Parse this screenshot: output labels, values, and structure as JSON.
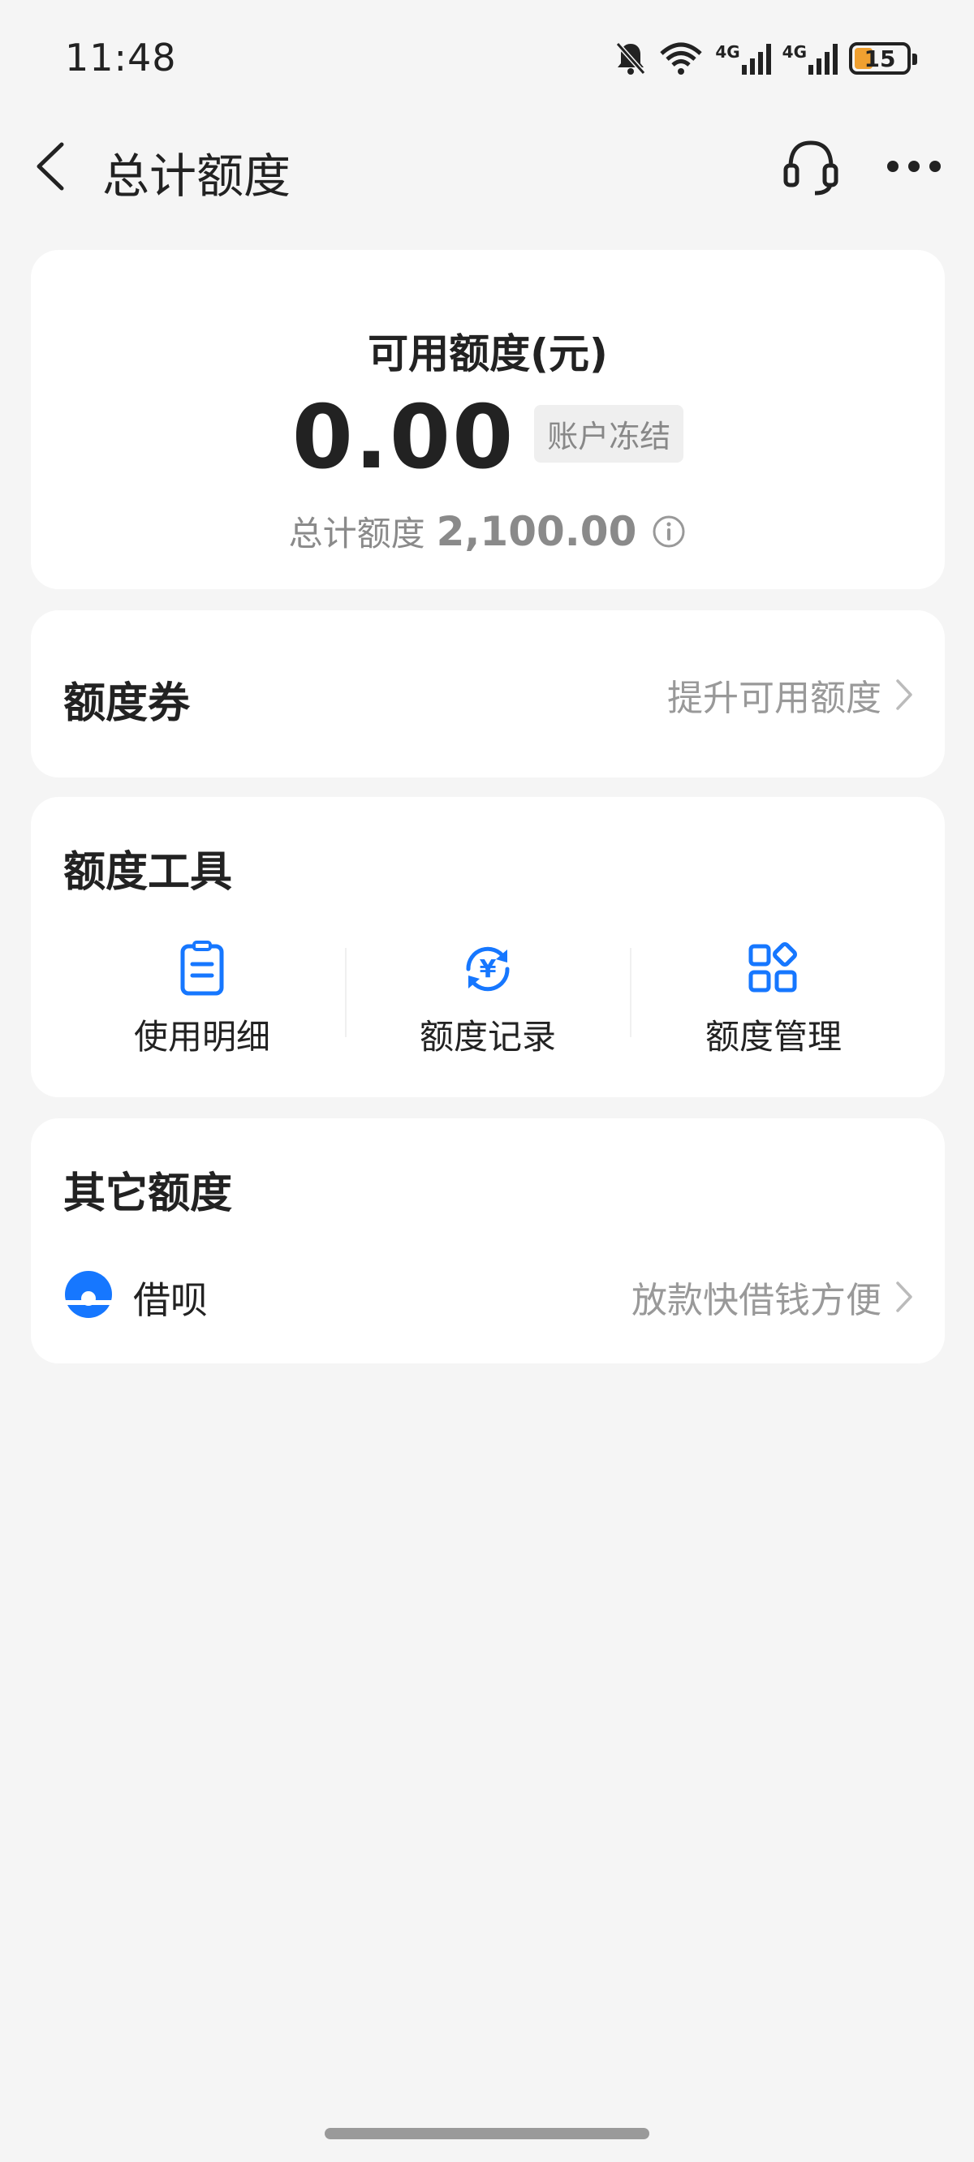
{
  "status_bar": {
    "time": "11:48",
    "network_1": "4G",
    "network_2": "4G",
    "battery": "15",
    "battery_color": "#f0a030"
  },
  "header": {
    "title": "总计额度",
    "back_icon": "chevron-left-icon",
    "service_icon": "headset-icon",
    "more_icon": "more-dots-icon"
  },
  "balance": {
    "available_label": "可用额度(元)",
    "available_amount": "0.00",
    "status_badge": "账户冻结",
    "total_label": "总计额度",
    "total_amount": "2,100.00"
  },
  "voucher": {
    "title": "额度券",
    "link_text": "提升可用额度"
  },
  "tools": {
    "title": "额度工具",
    "items": [
      {
        "label": "使用明细",
        "icon": "clipboard-list-icon"
      },
      {
        "label": "额度记录",
        "icon": "yuan-cycle-icon"
      },
      {
        "label": "额度管理",
        "icon": "apps-grid-icon"
      }
    ],
    "accent_color": "#1677ff"
  },
  "other": {
    "title": "其它额度",
    "items": [
      {
        "name": "借呗",
        "desc": "放款快借钱方便",
        "icon": "jiebei-logo-icon"
      }
    ]
  }
}
